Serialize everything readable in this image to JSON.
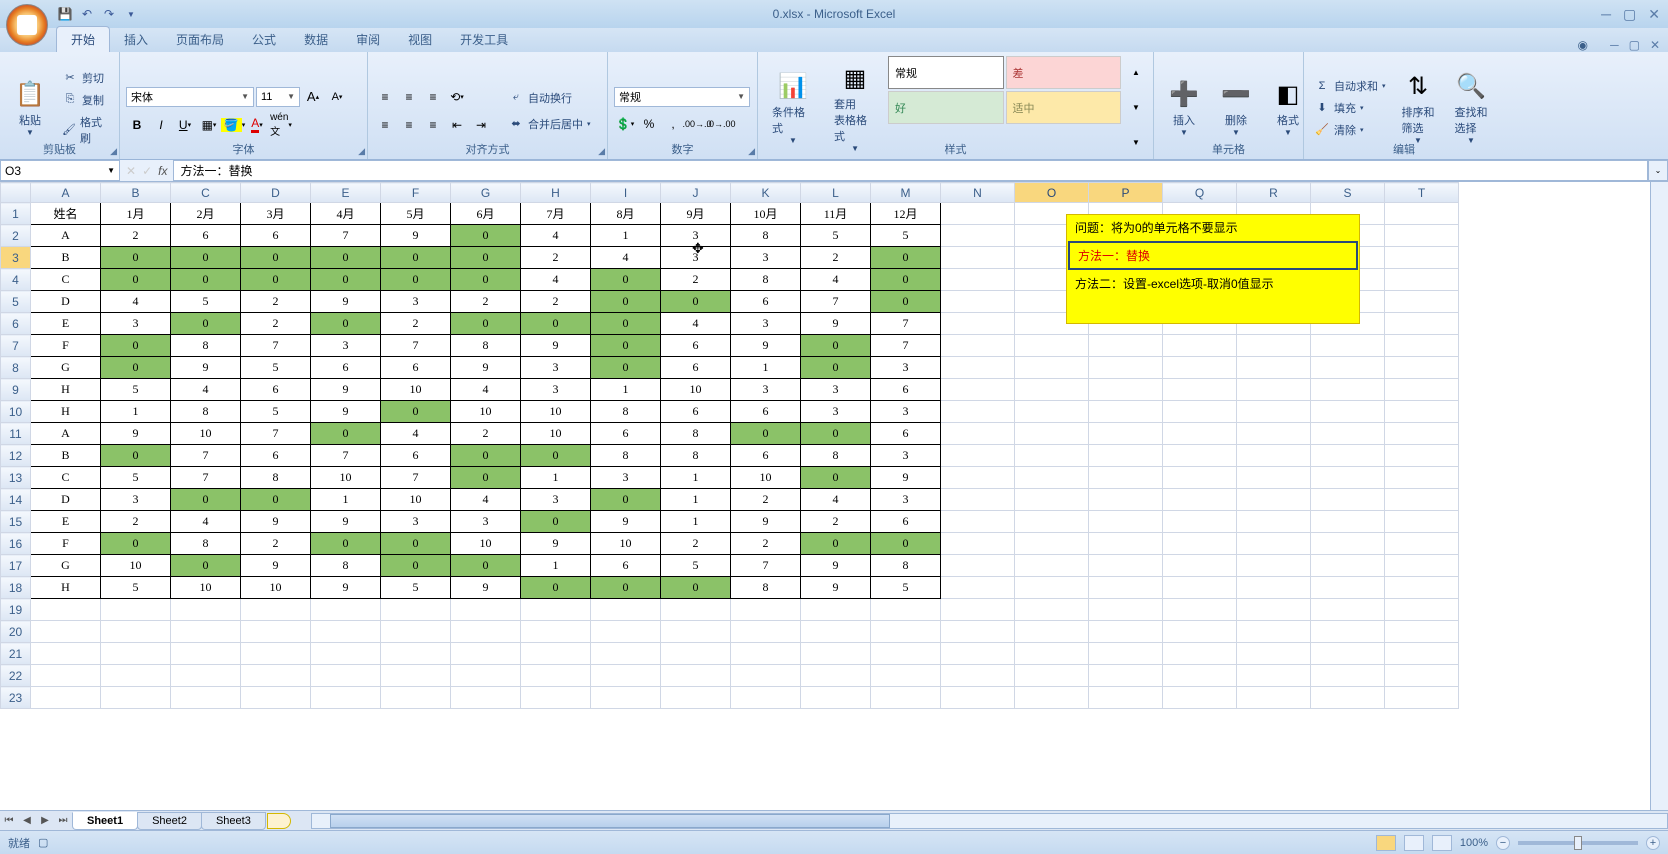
{
  "title": "0.xlsx - Microsoft Excel",
  "qat": {
    "save": "💾",
    "undo": "↶",
    "redo": "↷"
  },
  "tabs": [
    "开始",
    "插入",
    "页面布局",
    "公式",
    "数据",
    "审阅",
    "视图",
    "开发工具"
  ],
  "active_tab": 0,
  "ribbon": {
    "clipboard": {
      "paste": "粘贴",
      "cut": "剪切",
      "copy": "复制",
      "painter": "格式刷",
      "label": "剪贴板"
    },
    "font": {
      "name": "宋体",
      "size": "11",
      "bold": "B",
      "italic": "I",
      "underline": "U",
      "label": "字体"
    },
    "align": {
      "wrap": "自动换行",
      "merge": "合并后居中",
      "label": "对齐方式"
    },
    "number": {
      "format": "常规",
      "label": "数字"
    },
    "styles": {
      "cond": "条件格式",
      "table": "套用\n表格格式",
      "normal": "常规",
      "bad": "差",
      "good": "好",
      "neutral": "适中",
      "label": "样式"
    },
    "cells": {
      "insert": "插入",
      "delete": "删除",
      "format": "格式",
      "label": "单元格"
    },
    "editing": {
      "sum": "自动求和",
      "fill": "填充",
      "clear": "清除",
      "sort": "排序和\n筛选",
      "find": "查找和\n选择",
      "label": "编辑"
    }
  },
  "name_box": "O3",
  "formula": "方法一：替换",
  "columns": [
    "A",
    "B",
    "C",
    "D",
    "E",
    "F",
    "G",
    "H",
    "I",
    "J",
    "K",
    "L",
    "M",
    "N",
    "O",
    "P",
    "Q",
    "R",
    "S",
    "T"
  ],
  "selected_cols": [
    "O",
    "P"
  ],
  "selected_row": 3,
  "col_widths": {
    "data": 70,
    "after": 74
  },
  "headers_row": [
    "姓名",
    "1月",
    "2月",
    "3月",
    "4月",
    "5月",
    "6月",
    "7月",
    "8月",
    "9月",
    "10月",
    "11月",
    "12月"
  ],
  "rows": [
    [
      "A",
      2,
      6,
      6,
      7,
      9,
      0,
      4,
      1,
      3,
      8,
      5,
      5
    ],
    [
      "B",
      0,
      0,
      0,
      0,
      0,
      0,
      2,
      4,
      3,
      3,
      2,
      0
    ],
    [
      "C",
      0,
      0,
      0,
      0,
      0,
      0,
      4,
      0,
      2,
      8,
      4,
      0
    ],
    [
      "D",
      4,
      5,
      2,
      9,
      3,
      2,
      2,
      0,
      0,
      6,
      7,
      0
    ],
    [
      "E",
      3,
      0,
      2,
      0,
      2,
      0,
      0,
      0,
      4,
      3,
      9,
      7
    ],
    [
      "F",
      0,
      8,
      7,
      3,
      7,
      8,
      9,
      0,
      6,
      9,
      0,
      7
    ],
    [
      "G",
      0,
      9,
      5,
      6,
      6,
      9,
      3,
      0,
      6,
      1,
      0,
      3
    ],
    [
      "H",
      5,
      4,
      6,
      9,
      10,
      4,
      3,
      1,
      10,
      3,
      3,
      6
    ],
    [
      "H",
      1,
      8,
      5,
      9,
      0,
      10,
      10,
      8,
      6,
      6,
      3,
      3
    ],
    [
      "A",
      9,
      10,
      7,
      0,
      4,
      2,
      10,
      6,
      8,
      0,
      0,
      6
    ],
    [
      "B",
      0,
      7,
      6,
      7,
      6,
      0,
      0,
      8,
      8,
      6,
      8,
      3
    ],
    [
      "C",
      5,
      7,
      8,
      10,
      7,
      0,
      1,
      3,
      1,
      10,
      0,
      9
    ],
    [
      "D",
      3,
      0,
      0,
      1,
      10,
      4,
      3,
      0,
      1,
      2,
      4,
      3
    ],
    [
      "E",
      2,
      4,
      9,
      9,
      3,
      3,
      0,
      9,
      1,
      9,
      2,
      6
    ],
    [
      "F",
      0,
      8,
      2,
      0,
      0,
      10,
      9,
      10,
      2,
      2,
      0,
      0
    ],
    [
      "G",
      10,
      0,
      9,
      8,
      0,
      0,
      1,
      6,
      5,
      7,
      9,
      8
    ],
    [
      "H",
      5,
      10,
      10,
      9,
      5,
      9,
      0,
      0,
      0,
      8,
      9,
      5
    ]
  ],
  "empty_rows": [
    19,
    20,
    21,
    22,
    23
  ],
  "notes": {
    "line1": "问题：将为0的单元格不要显示",
    "line2": "方法一：替换",
    "line3": "方法二：设置-excel选项-取消0值显示"
  },
  "sheet_tabs": [
    "Sheet1",
    "Sheet2",
    "Sheet3"
  ],
  "active_sheet": 0,
  "status": {
    "ready": "就绪",
    "zoom": "100%"
  }
}
